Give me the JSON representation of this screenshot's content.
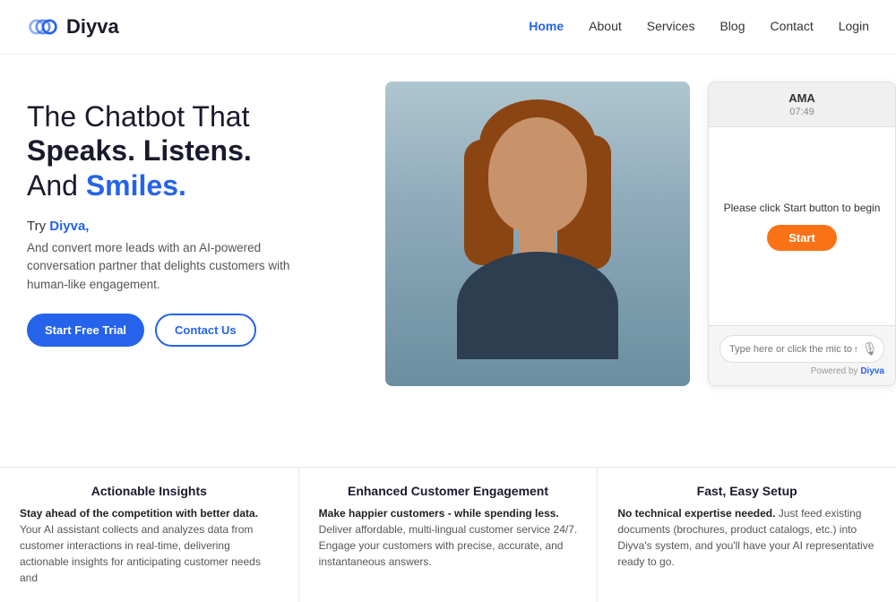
{
  "brand": {
    "logo_text": "Diyva",
    "logo_alt": "Diyva logo"
  },
  "nav": {
    "links": [
      {
        "label": "Home",
        "active": true
      },
      {
        "label": "About",
        "active": false
      },
      {
        "label": "Services",
        "active": false
      },
      {
        "label": "Blog",
        "active": false
      },
      {
        "label": "Contact",
        "active": false
      },
      {
        "label": "Login",
        "active": false
      }
    ]
  },
  "hero": {
    "headline_line1": "The Chatbot That",
    "headline_line2_bold": "Speaks. Listens.",
    "headline_line3_part1": "And ",
    "headline_line3_smiles": "Smiles.",
    "try_label": "Try ",
    "try_brand": "Diyva,",
    "tagline": "And convert more leads with an AI-powered conversation partner that delights customers with human-like engagement.",
    "btn_primary": "Start Free Trial",
    "btn_secondary": "Contact Us"
  },
  "chatbot": {
    "title": "AMA",
    "time": "07:49",
    "start_message": "Please click Start button to begin",
    "start_btn": "Start",
    "input_placeholder": "Type here or click the mic to speak",
    "powered_by_text": "Powered by ",
    "powered_by_brand": "Diyva"
  },
  "features": [
    {
      "title": "Actionable Insights",
      "bold_text": "Stay ahead of the competition with better data.",
      "description": " Your AI assistant collects and analyzes data from customer interactions in real-time, delivering actionable insights for anticipating customer needs and"
    },
    {
      "title": "Enhanced Customer Engagement",
      "bold_text": "Make happier customers - while spending less.",
      "description": " Deliver affordable, multi-lingual customer service 24/7. Engage your customers with precise, accurate, and instantaneous answers."
    },
    {
      "title": "Fast, Easy Setup",
      "bold_text": "No technical expertise needed.",
      "description": " Just feed existing documents (brochures, product catalogs, etc.) into Diyva's system, and you'll have your AI representative ready to go."
    }
  ]
}
